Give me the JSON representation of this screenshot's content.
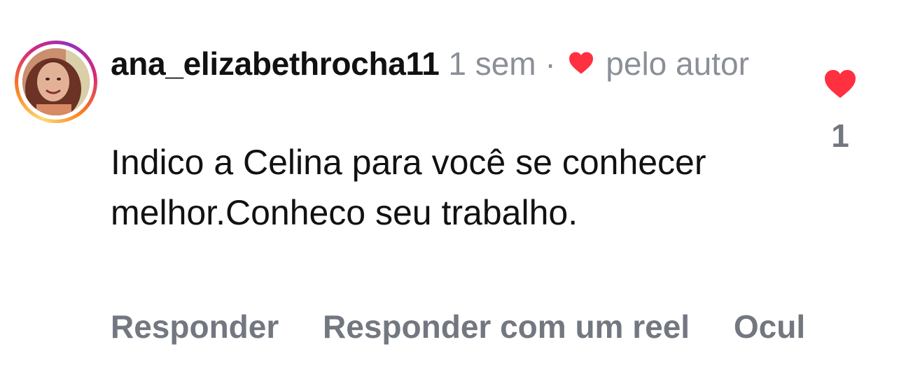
{
  "comment": {
    "username": "ana_elizabethrocha11",
    "time": "1 sem",
    "separator": "·",
    "liked_by_author": "pelo autor",
    "text": "Indico a Celina para você se conhecer melhor.Conheco seu trabalho.",
    "actions": {
      "reply": "Responder",
      "reply_reel": "Responder com um reel",
      "hide": "Ocul"
    },
    "like_count": "1",
    "like_icon": "heart-filled-icon",
    "like_color": "#ff3040"
  }
}
